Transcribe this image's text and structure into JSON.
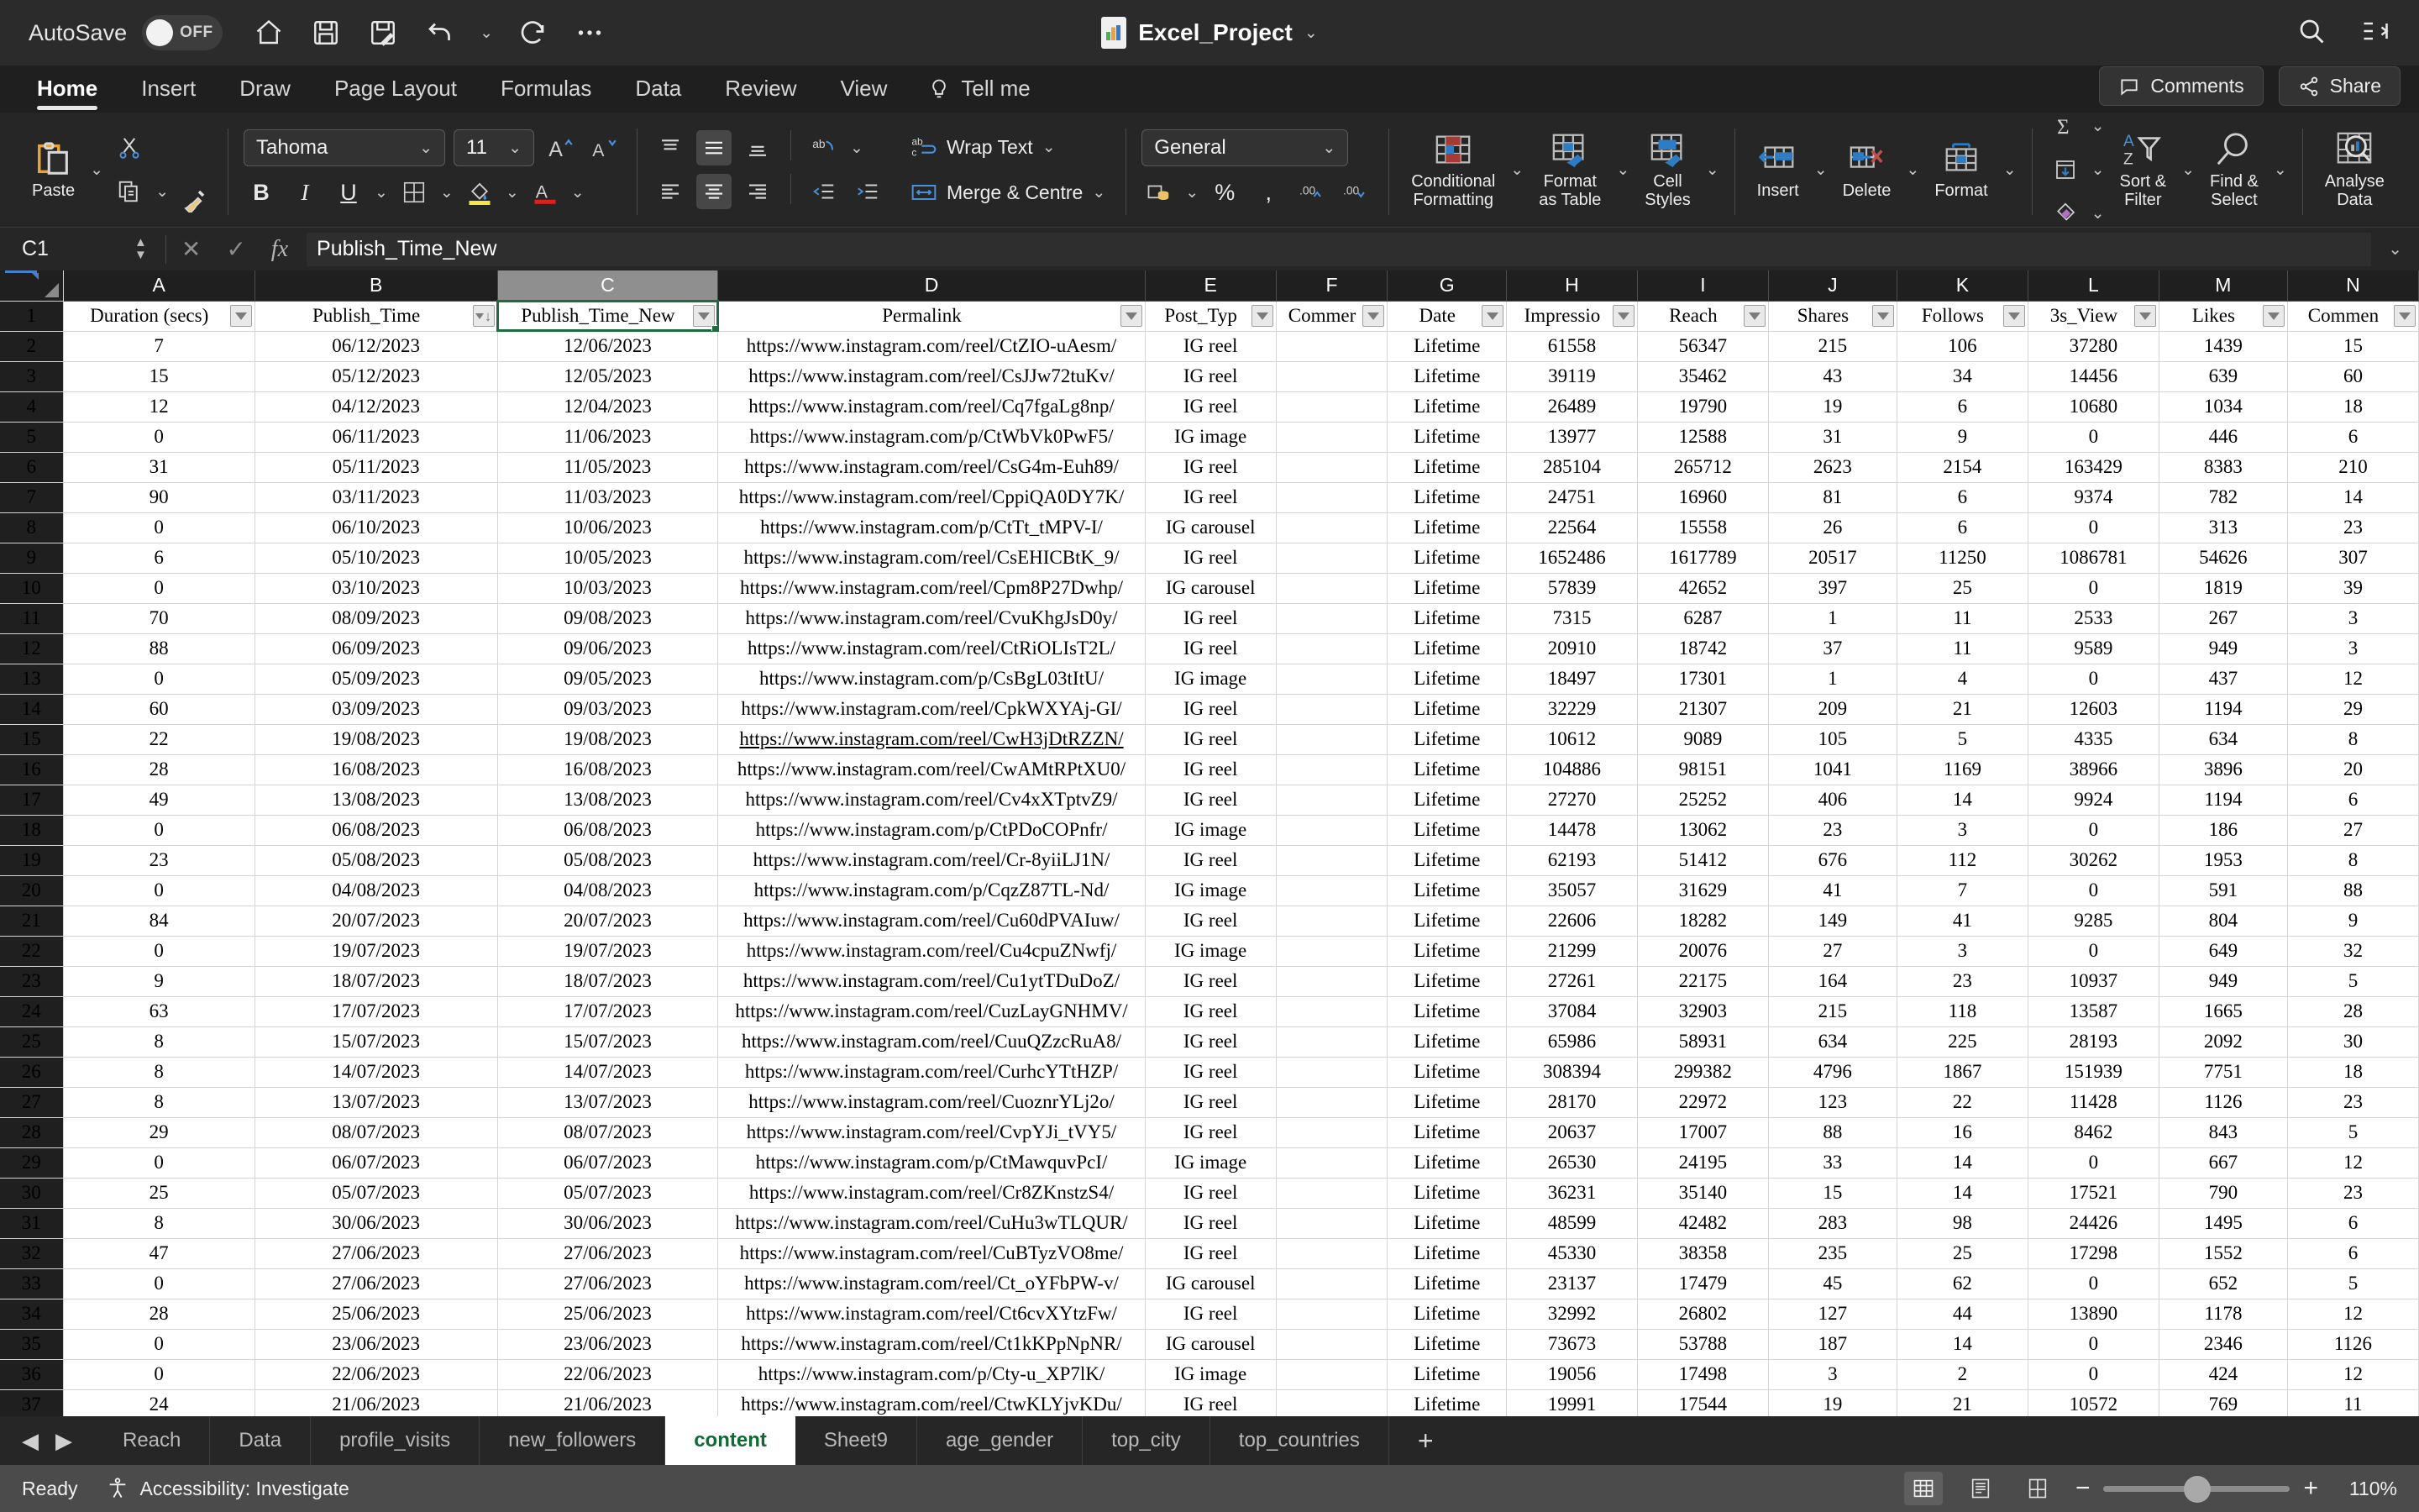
{
  "titlebar": {
    "autosave_label": "AutoSave",
    "autosave_state": "OFF",
    "document_title": "Excel_Project",
    "quick_access": [
      "home-icon",
      "save-icon",
      "save-as-icon",
      "undo-icon",
      "redo-icon",
      "more-icon"
    ],
    "search_icon": "search-icon",
    "ribbon_display_icon": "ribbon-display-icon"
  },
  "ribbon_tabs": {
    "tabs": [
      "Home",
      "Insert",
      "Draw",
      "Page Layout",
      "Formulas",
      "Data",
      "Review",
      "View"
    ],
    "active": "Home",
    "tell_me": "Tell me",
    "comments": "Comments",
    "share": "Share"
  },
  "ribbon": {
    "paste": "Paste",
    "font_name": "Tahoma",
    "font_size": "11",
    "bold": "B",
    "italic": "I",
    "underline": "U",
    "wrap_text": "Wrap Text",
    "merge_centre": "Merge & Centre",
    "number_format": "General",
    "percent": "%",
    "comma": ",",
    "conditional_formatting": "Conditional\nFormatting",
    "format_as_table": "Format\nas Table",
    "cell_styles": "Cell\nStyles",
    "insert": "Insert",
    "delete": "Delete",
    "format": "Format",
    "sort_filter": "Sort &\nFilter",
    "find_select": "Find &\nSelect",
    "analyse_data": "Analyse\nData"
  },
  "formula_bar": {
    "name_box": "C1",
    "cancel_icon": "cancel-icon",
    "enter_icon": "enter-icon",
    "fx_icon": "fx-icon",
    "formula_value": "Publish_Time_New"
  },
  "grid": {
    "column_letters": [
      "A",
      "B",
      "C",
      "D",
      "E",
      "F",
      "G",
      "H",
      "I",
      "J",
      "K",
      "L",
      "M",
      "N"
    ],
    "selected_column": "C",
    "selected_cell": "C1",
    "headers": [
      "Duration (secs)",
      "Publish_Time",
      "Publish_Time_New",
      "Permalink",
      "Post_Typ",
      "Commer",
      "Date",
      "Impressio",
      "Reach",
      "Shares",
      "Follows",
      "3s_View",
      "Likes",
      "Commen"
    ],
    "header_sorted_index": 1,
    "rows": [
      {
        "n": 2,
        "cells": [
          "7",
          "06/12/2023",
          "12/06/2023",
          "https://www.instagram.com/reel/CtZIO-uAesm/",
          "IG reel",
          "",
          "Lifetime",
          "61558",
          "56347",
          "215",
          "106",
          "37280",
          "1439",
          "15"
        ]
      },
      {
        "n": 3,
        "cells": [
          "15",
          "05/12/2023",
          "12/05/2023",
          "https://www.instagram.com/reel/CsJJw72tuKv/",
          "IG reel",
          "",
          "Lifetime",
          "39119",
          "35462",
          "43",
          "34",
          "14456",
          "639",
          "60"
        ]
      },
      {
        "n": 4,
        "cells": [
          "12",
          "04/12/2023",
          "12/04/2023",
          "https://www.instagram.com/reel/Cq7fgaLg8np/",
          "IG reel",
          "",
          "Lifetime",
          "26489",
          "19790",
          "19",
          "6",
          "10680",
          "1034",
          "18"
        ]
      },
      {
        "n": 5,
        "cells": [
          "0",
          "06/11/2023",
          "11/06/2023",
          "https://www.instagram.com/p/CtWbVk0PwF5/",
          "IG image",
          "",
          "Lifetime",
          "13977",
          "12588",
          "31",
          "9",
          "0",
          "446",
          "6"
        ]
      },
      {
        "n": 6,
        "cells": [
          "31",
          "05/11/2023",
          "11/05/2023",
          "https://www.instagram.com/reel/CsG4m-Euh89/",
          "IG reel",
          "",
          "Lifetime",
          "285104",
          "265712",
          "2623",
          "2154",
          "163429",
          "8383",
          "210"
        ]
      },
      {
        "n": 7,
        "cells": [
          "90",
          "03/11/2023",
          "11/03/2023",
          "https://www.instagram.com/reel/CppiQA0DY7K/",
          "IG reel",
          "",
          "Lifetime",
          "24751",
          "16960",
          "81",
          "6",
          "9374",
          "782",
          "14"
        ]
      },
      {
        "n": 8,
        "cells": [
          "0",
          "06/10/2023",
          "10/06/2023",
          "https://www.instagram.com/p/CtTt_tMPV-I/",
          "IG carousel",
          "",
          "Lifetime",
          "22564",
          "15558",
          "26",
          "6",
          "0",
          "313",
          "23"
        ]
      },
      {
        "n": 9,
        "cells": [
          "6",
          "05/10/2023",
          "10/05/2023",
          "https://www.instagram.com/reel/CsEHICBtK_9/",
          "IG reel",
          "",
          "Lifetime",
          "1652486",
          "1617789",
          "20517",
          "11250",
          "1086781",
          "54626",
          "307"
        ]
      },
      {
        "n": 10,
        "cells": [
          "0",
          "03/10/2023",
          "10/03/2023",
          "https://www.instagram.com/reel/Cpm8P27Dwhp/",
          "IG carousel",
          "",
          "Lifetime",
          "57839",
          "42652",
          "397",
          "25",
          "0",
          "1819",
          "39"
        ]
      },
      {
        "n": 11,
        "cells": [
          "70",
          "08/09/2023",
          "09/08/2023",
          "https://www.instagram.com/reel/CvuKhgJsD0y/",
          "IG reel",
          "",
          "Lifetime",
          "7315",
          "6287",
          "1",
          "11",
          "2533",
          "267",
          "3"
        ]
      },
      {
        "n": 12,
        "cells": [
          "88",
          "06/09/2023",
          "09/06/2023",
          "https://www.instagram.com/reel/CtRiOLIsT2L/",
          "IG reel",
          "",
          "Lifetime",
          "20910",
          "18742",
          "37",
          "11",
          "9589",
          "949",
          "3"
        ]
      },
      {
        "n": 13,
        "cells": [
          "0",
          "05/09/2023",
          "09/05/2023",
          "https://www.instagram.com/p/CsBgL03tItU/",
          "IG image",
          "",
          "Lifetime",
          "18497",
          "17301",
          "1",
          "4",
          "0",
          "437",
          "12"
        ]
      },
      {
        "n": 14,
        "cells": [
          "60",
          "03/09/2023",
          "09/03/2023",
          "https://www.instagram.com/reel/CpkWXYAj-GI/",
          "IG reel",
          "",
          "Lifetime",
          "32229",
          "21307",
          "209",
          "21",
          "12603",
          "1194",
          "29"
        ]
      },
      {
        "n": 15,
        "cells": [
          "22",
          "19/08/2023",
          "19/08/2023",
          "https://www.instagram.com/reel/CwH3jDtRZZN/",
          "IG reel",
          "",
          "Lifetime",
          "10612",
          "9089",
          "105",
          "5",
          "4335",
          "634",
          "8"
        ],
        "link": true
      },
      {
        "n": 16,
        "cells": [
          "28",
          "16/08/2023",
          "16/08/2023",
          "https://www.instagram.com/reel/CwAMtRPtXU0/",
          "IG reel",
          "",
          "Lifetime",
          "104886",
          "98151",
          "1041",
          "1169",
          "38966",
          "3896",
          "20"
        ],
        "cursor": true
      },
      {
        "n": 17,
        "cells": [
          "49",
          "13/08/2023",
          "13/08/2023",
          "https://www.instagram.com/reel/Cv4xXTptvZ9/",
          "IG reel",
          "",
          "Lifetime",
          "27270",
          "25252",
          "406",
          "14",
          "9924",
          "1194",
          "6"
        ]
      },
      {
        "n": 18,
        "cells": [
          "0",
          "06/08/2023",
          "06/08/2023",
          "https://www.instagram.com/p/CtPDoCOPnfr/",
          "IG image",
          "",
          "Lifetime",
          "14478",
          "13062",
          "23",
          "3",
          "0",
          "186",
          "27"
        ]
      },
      {
        "n": 19,
        "cells": [
          "23",
          "05/08/2023",
          "05/08/2023",
          "https://www.instagram.com/reel/Cr-8yiiLJ1N/",
          "IG reel",
          "",
          "Lifetime",
          "62193",
          "51412",
          "676",
          "112",
          "30262",
          "1953",
          "8"
        ]
      },
      {
        "n": 20,
        "cells": [
          "0",
          "04/08/2023",
          "04/08/2023",
          "https://www.instagram.com/p/CqzZ87TL-Nd/",
          "IG image",
          "",
          "Lifetime",
          "35057",
          "31629",
          "41",
          "7",
          "0",
          "591",
          "88"
        ]
      },
      {
        "n": 21,
        "cells": [
          "84",
          "20/07/2023",
          "20/07/2023",
          "https://www.instagram.com/reel/Cu60dPVAIuw/",
          "IG reel",
          "",
          "Lifetime",
          "22606",
          "18282",
          "149",
          "41",
          "9285",
          "804",
          "9"
        ]
      },
      {
        "n": 22,
        "cells": [
          "0",
          "19/07/2023",
          "19/07/2023",
          "https://www.instagram.com/reel/Cu4cpuZNwfj/",
          "IG image",
          "",
          "Lifetime",
          "21299",
          "20076",
          "27",
          "3",
          "0",
          "649",
          "32"
        ]
      },
      {
        "n": 23,
        "cells": [
          "9",
          "18/07/2023",
          "18/07/2023",
          "https://www.instagram.com/reel/Cu1ytTDuDoZ/",
          "IG reel",
          "",
          "Lifetime",
          "27261",
          "22175",
          "164",
          "23",
          "10937",
          "949",
          "5"
        ]
      },
      {
        "n": 24,
        "cells": [
          "63",
          "17/07/2023",
          "17/07/2023",
          "https://www.instagram.com/reel/CuzLayGNHMV/",
          "IG reel",
          "",
          "Lifetime",
          "37084",
          "32903",
          "215",
          "118",
          "13587",
          "1665",
          "28"
        ]
      },
      {
        "n": 25,
        "cells": [
          "8",
          "15/07/2023",
          "15/07/2023",
          "https://www.instagram.com/reel/CuuQZzcRuA8/",
          "IG reel",
          "",
          "Lifetime",
          "65986",
          "58931",
          "634",
          "225",
          "28193",
          "2092",
          "30"
        ]
      },
      {
        "n": 26,
        "cells": [
          "8",
          "14/07/2023",
          "14/07/2023",
          "https://www.instagram.com/reel/CurhcYTtHZP/",
          "IG reel",
          "",
          "Lifetime",
          "308394",
          "299382",
          "4796",
          "1867",
          "151939",
          "7751",
          "18"
        ]
      },
      {
        "n": 27,
        "cells": [
          "8",
          "13/07/2023",
          "13/07/2023",
          "https://www.instagram.com/reel/CuoznrYLj2o/",
          "IG reel",
          "",
          "Lifetime",
          "28170",
          "22972",
          "123",
          "22",
          "11428",
          "1126",
          "23"
        ]
      },
      {
        "n": 28,
        "cells": [
          "29",
          "08/07/2023",
          "08/07/2023",
          "https://www.instagram.com/reel/CvpYJi_tVY5/",
          "IG reel",
          "",
          "Lifetime",
          "20637",
          "17007",
          "88",
          "16",
          "8462",
          "843",
          "5"
        ]
      },
      {
        "n": 29,
        "cells": [
          "0",
          "06/07/2023",
          "06/07/2023",
          "https://www.instagram.com/p/CtMawquvPcI/",
          "IG image",
          "",
          "Lifetime",
          "26530",
          "24195",
          "33",
          "14",
          "0",
          "667",
          "12"
        ]
      },
      {
        "n": 30,
        "cells": [
          "25",
          "05/07/2023",
          "05/07/2023",
          "https://www.instagram.com/reel/Cr8ZKnstzS4/",
          "IG reel",
          "",
          "Lifetime",
          "36231",
          "35140",
          "15",
          "14",
          "17521",
          "790",
          "23"
        ]
      },
      {
        "n": 31,
        "cells": [
          "8",
          "30/06/2023",
          "30/06/2023",
          "https://www.instagram.com/reel/CuHu3wTLQUR/",
          "IG reel",
          "",
          "Lifetime",
          "48599",
          "42482",
          "283",
          "98",
          "24426",
          "1495",
          "6"
        ]
      },
      {
        "n": 32,
        "cells": [
          "47",
          "27/06/2023",
          "27/06/2023",
          "https://www.instagram.com/reel/CuBTyzVO8me/",
          "IG reel",
          "",
          "Lifetime",
          "45330",
          "38358",
          "235",
          "25",
          "17298",
          "1552",
          "6"
        ]
      },
      {
        "n": 33,
        "cells": [
          "0",
          "27/06/2023",
          "27/06/2023",
          "https://www.instagram.com/reel/Ct_oYFbPW-v/",
          "IG carousel",
          "",
          "Lifetime",
          "23137",
          "17479",
          "45",
          "62",
          "0",
          "652",
          "5"
        ]
      },
      {
        "n": 34,
        "cells": [
          "28",
          "25/06/2023",
          "25/06/2023",
          "https://www.instagram.com/reel/Ct6cvXYtzFw/",
          "IG reel",
          "",
          "Lifetime",
          "32992",
          "26802",
          "127",
          "44",
          "13890",
          "1178",
          "12"
        ]
      },
      {
        "n": 35,
        "cells": [
          "0",
          "23/06/2023",
          "23/06/2023",
          "https://www.instagram.com/reel/Ct1kKPpNpNR/",
          "IG carousel",
          "",
          "Lifetime",
          "73673",
          "53788",
          "187",
          "14",
          "0",
          "2346",
          "1126"
        ]
      },
      {
        "n": 36,
        "cells": [
          "0",
          "22/06/2023",
          "22/06/2023",
          "https://www.instagram.com/p/Cty-u_XP7lK/",
          "IG image",
          "",
          "Lifetime",
          "19056",
          "17498",
          "3",
          "2",
          "0",
          "424",
          "12"
        ]
      },
      {
        "n": 37,
        "cells": [
          "24",
          "21/06/2023",
          "21/06/2023",
          "https://www.instagram.com/reel/CtwKLYjvKDu/",
          "IG reel",
          "",
          "Lifetime",
          "19991",
          "17544",
          "19",
          "21",
          "10572",
          "769",
          "11"
        ]
      }
    ]
  },
  "sheet_tabs": {
    "tabs": [
      "Reach",
      "Data",
      "profile_visits",
      "new_followers",
      "content",
      "Sheet9",
      "age_gender",
      "top_city",
      "top_countries"
    ],
    "active": "content",
    "add_label": "+"
  },
  "status_bar": {
    "status": "Ready",
    "accessibility": "Accessibility: Investigate",
    "views": [
      "normal-view-icon",
      "page-layout-icon",
      "page-break-icon"
    ],
    "zoom_out": "−",
    "zoom_in": "+",
    "zoom_level": "110%"
  }
}
